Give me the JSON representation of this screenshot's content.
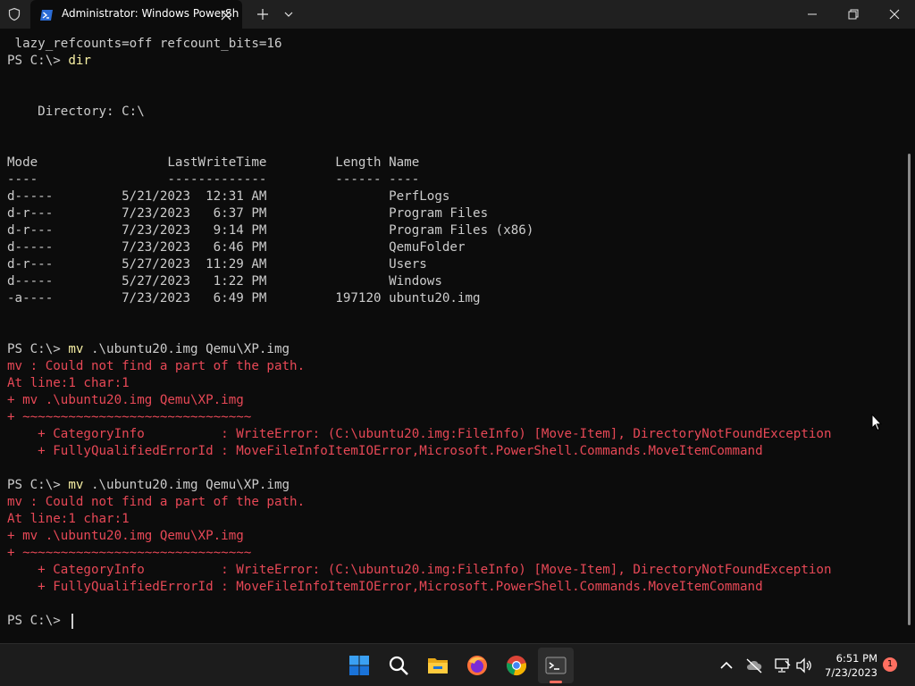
{
  "window": {
    "tab_title": "Administrator: Windows PowerShell"
  },
  "terminal": {
    "lines": [
      {
        "text": " lazy_refcounts=off refcount_bits=16",
        "type": "out"
      },
      {
        "prompt": "PS C:\\> ",
        "command": "dir",
        "type": "cmd"
      },
      {
        "text": "",
        "type": "out"
      },
      {
        "text": "",
        "type": "out"
      },
      {
        "text": "    Directory: C:\\",
        "type": "out"
      },
      {
        "text": "",
        "type": "out"
      },
      {
        "text": "",
        "type": "out"
      },
      {
        "text": "Mode                 LastWriteTime         Length Name",
        "type": "out"
      },
      {
        "text": "----                 -------------         ------ ----",
        "type": "out"
      },
      {
        "text": "d-----         5/21/2023  12:31 AM                PerfLogs",
        "type": "out"
      },
      {
        "text": "d-r---         7/23/2023   6:37 PM                Program Files",
        "type": "out"
      },
      {
        "text": "d-r---         7/23/2023   9:14 PM                Program Files (x86)",
        "type": "out"
      },
      {
        "text": "d-----         7/23/2023   6:46 PM                QemuFolder",
        "type": "out"
      },
      {
        "text": "d-r---         5/27/2023  11:29 AM                Users",
        "type": "out"
      },
      {
        "text": "d-----         5/27/2023   1:22 PM                Windows",
        "type": "out"
      },
      {
        "text": "-a----         7/23/2023   6:49 PM         197120 ubuntu20.img",
        "type": "out"
      },
      {
        "text": "",
        "type": "out"
      },
      {
        "text": "",
        "type": "out"
      },
      {
        "prompt": "PS C:\\> ",
        "command": "mv",
        "args": " .\\ubuntu20.img Qemu\\XP.img",
        "type": "cmd"
      },
      {
        "text": "mv : Could not find a part of the path.",
        "type": "err"
      },
      {
        "text": "At line:1 char:1",
        "type": "err"
      },
      {
        "text": "+ mv .\\ubuntu20.img Qemu\\XP.img",
        "type": "err"
      },
      {
        "text": "+ ~~~~~~~~~~~~~~~~~~~~~~~~~~~~~~",
        "type": "err"
      },
      {
        "text": "    + CategoryInfo          : WriteError: (C:\\ubuntu20.img:FileInfo) [Move-Item], DirectoryNotFoundException",
        "type": "err"
      },
      {
        "text": "    + FullyQualifiedErrorId : MoveFileInfoItemIOError,Microsoft.PowerShell.Commands.MoveItemCommand",
        "type": "err"
      },
      {
        "text": "",
        "type": "out"
      },
      {
        "prompt": "PS C:\\> ",
        "command": "mv",
        "args": " .\\ubuntu20.img Qemu\\XP.img",
        "type": "cmd"
      },
      {
        "text": "mv : Could not find a part of the path.",
        "type": "err"
      },
      {
        "text": "At line:1 char:1",
        "type": "err"
      },
      {
        "text": "+ mv .\\ubuntu20.img Qemu\\XP.img",
        "type": "err"
      },
      {
        "text": "+ ~~~~~~~~~~~~~~~~~~~~~~~~~~~~~~",
        "type": "err"
      },
      {
        "text": "    + CategoryInfo          : WriteError: (C:\\ubuntu20.img:FileInfo) [Move-Item], DirectoryNotFoundException",
        "type": "err"
      },
      {
        "text": "    + FullyQualifiedErrorId : MoveFileInfoItemIOError,Microsoft.PowerShell.Commands.MoveItemCommand",
        "type": "err"
      },
      {
        "text": "",
        "type": "out"
      },
      {
        "prompt": "PS C:\\> ",
        "command": "",
        "type": "cmd"
      }
    ]
  },
  "taskbar": {
    "time": "6:51 PM",
    "date": "7/23/2023",
    "notification_count": "1"
  },
  "colors": {
    "terminal_bg": "#0c0c0c",
    "foreground": "#cccccc",
    "command": "#f9f1a5",
    "error": "#e74856",
    "accent": "#ff6f61"
  },
  "icons": [
    "shield-icon",
    "powershell-icon",
    "close-icon",
    "plus-icon",
    "chevron-down-icon",
    "minimize-icon",
    "maximize-icon",
    "window-close-icon",
    "windows-start-icon",
    "search-icon",
    "file-explorer-icon",
    "firefox-icon",
    "chrome-icon",
    "terminal-icon",
    "chevron-up-icon",
    "cloud-off-icon",
    "network-icon",
    "volume-icon"
  ]
}
